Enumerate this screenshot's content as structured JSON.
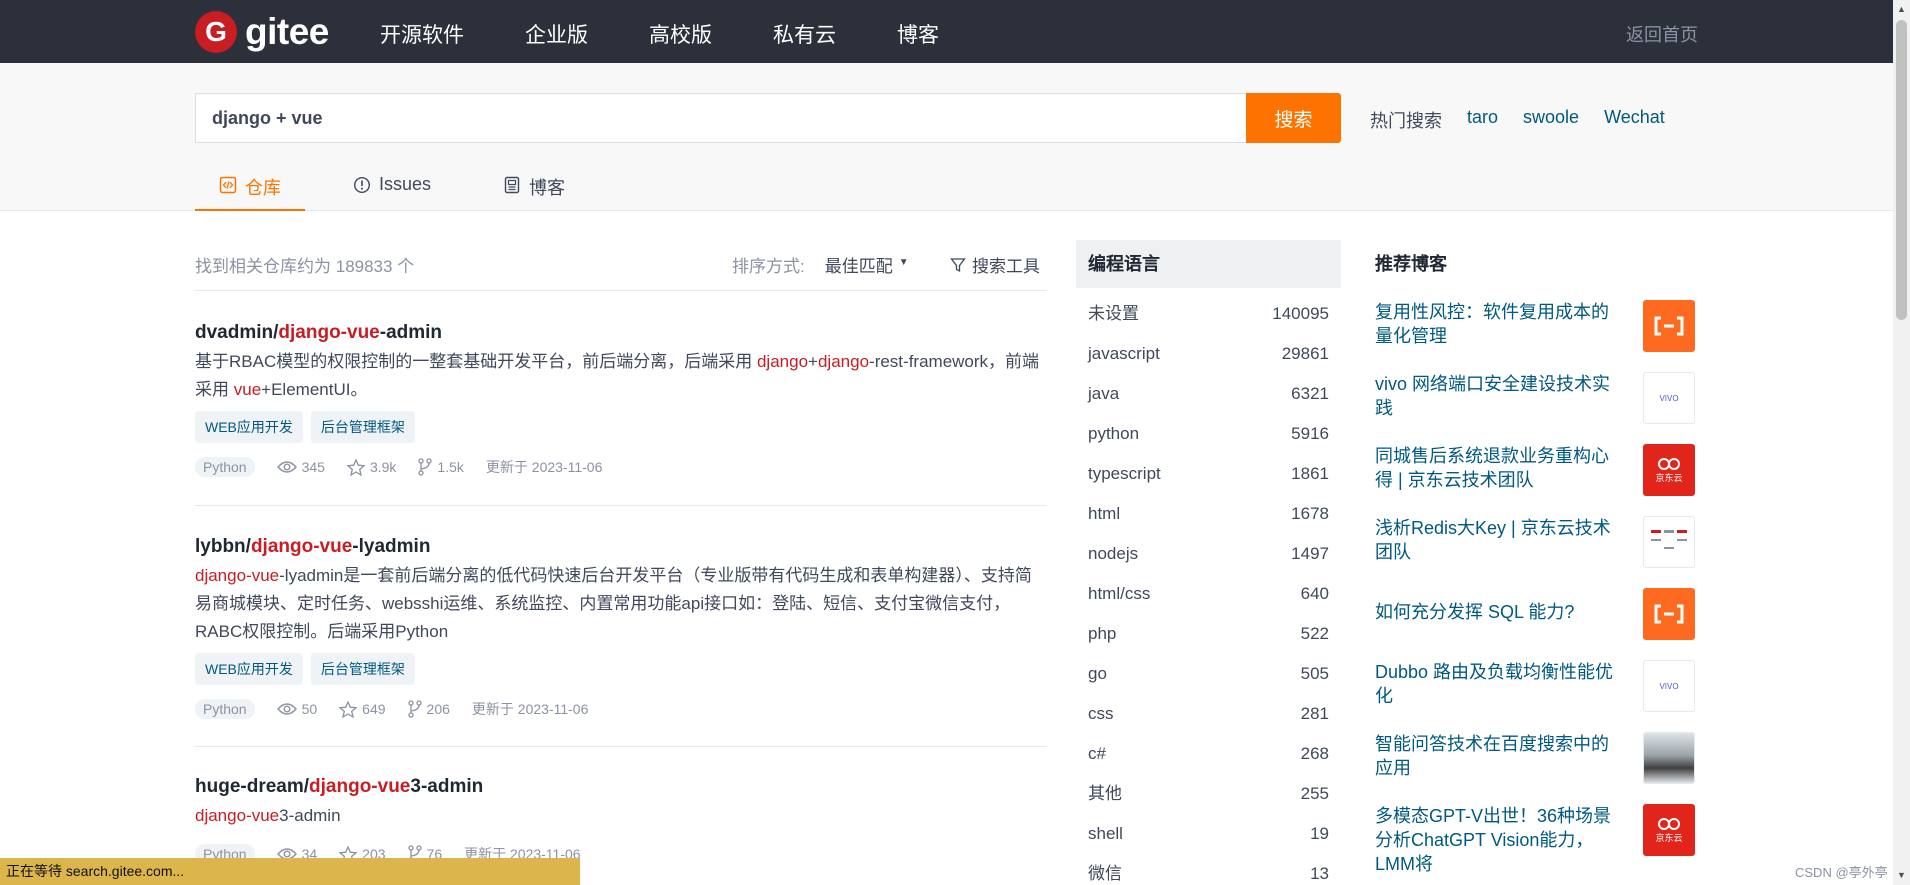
{
  "header": {
    "logo_mark": "G",
    "logo_text": "gitee",
    "nav": [
      "开源软件",
      "企业版",
      "高校版",
      "私有云",
      "博客"
    ],
    "home_link": "返回首页"
  },
  "search": {
    "query": "django + vue",
    "button": "搜索",
    "hot_label": "热门搜索",
    "hot_terms": [
      "taro",
      "swoole",
      "Wechat"
    ]
  },
  "tabs": [
    {
      "label": "仓库",
      "icon": "code-icon",
      "active": true
    },
    {
      "label": "Issues",
      "icon": "issue-icon",
      "active": false
    },
    {
      "label": "博客",
      "icon": "blog-icon",
      "active": false
    }
  ],
  "results": {
    "found_prefix": "找到相关仓库约为",
    "found_count": "189833",
    "found_suffix": "个",
    "sort_label": "排序方式:",
    "sort_value": "最佳匹配",
    "tools_label": "搜索工具"
  },
  "repos": [
    {
      "owner": "dvadmin/",
      "name_hl": "django-vue",
      "name_rest": "-admin",
      "desc_parts": [
        {
          "t": "基于RBAC模型的权限控制的一整套基础开发平台，前后端分离，后端采用 ",
          "hl": false
        },
        {
          "t": "django",
          "hl": true
        },
        {
          "t": "+",
          "hl": false
        },
        {
          "t": "django",
          "hl": true
        },
        {
          "t": "-rest-framework，前端采用 ",
          "hl": false
        },
        {
          "t": "vue",
          "hl": true
        },
        {
          "t": "+ElementUI。",
          "hl": false
        }
      ],
      "tags": [
        "WEB应用开发",
        "后台管理框架"
      ],
      "lang": "Python",
      "watch": "345",
      "stars": "3.9k",
      "forks": "1.5k",
      "updated": "更新于 2023-11-06"
    },
    {
      "owner": "lybbn/",
      "name_hl": "django-vue",
      "name_rest": "-lyadmin",
      "desc_parts": [
        {
          "t": "django-vue",
          "hl": true
        },
        {
          "t": "-lyadmin是一套前后端分离的低代码快速后台开发平台（专业版带有代码生成和表单构建器）、支持简易商城模块、定时任务、websshi运维、系统监控、内置常用功能api接口如：登陆、短信、支付宝微信支付，RABC权限控制。后端采用Python",
          "hl": false
        }
      ],
      "tags": [
        "WEB应用开发",
        "后台管理框架"
      ],
      "lang": "Python",
      "watch": "50",
      "stars": "649",
      "forks": "206",
      "updated": "更新于 2023-11-06"
    },
    {
      "owner": "huge-dream/",
      "name_hl": "django-vue",
      "name_rest": "3-admin",
      "desc_parts": [
        {
          "t": "django-vue",
          "hl": true
        },
        {
          "t": "3-admin",
          "hl": false
        }
      ],
      "tags": [],
      "lang": "Python",
      "watch": "34",
      "stars": "203",
      "forks": "76",
      "updated": "更新于 2023-11-06"
    }
  ],
  "languages": {
    "heading": "编程语言",
    "items": [
      {
        "name": "未设置",
        "count": "140095"
      },
      {
        "name": "javascript",
        "count": "29861"
      },
      {
        "name": "java",
        "count": "6321"
      },
      {
        "name": "python",
        "count": "5916"
      },
      {
        "name": "typescript",
        "count": "1861"
      },
      {
        "name": "html",
        "count": "1678"
      },
      {
        "name": "nodejs",
        "count": "1497"
      },
      {
        "name": "html/css",
        "count": "640"
      },
      {
        "name": "php",
        "count": "522"
      },
      {
        "name": "go",
        "count": "505"
      },
      {
        "name": "css",
        "count": "281"
      },
      {
        "name": "c#",
        "count": "268"
      },
      {
        "name": "其他",
        "count": "255"
      },
      {
        "name": "shell",
        "count": "19"
      },
      {
        "name": "微信",
        "count": "13"
      }
    ]
  },
  "blogs": {
    "heading": "推荐博客",
    "items": [
      {
        "title": "复用性风控：软件复用成本的量化管理",
        "thumb": "orange"
      },
      {
        "title": "vivo 网络端口安全建设技术实践",
        "thumb": "vivo",
        "thumb_text": "VIVO"
      },
      {
        "title": "同城售后系统退款业务重构心得 | 京东云技术团队",
        "thumb": "jd",
        "thumb_text": "京东云"
      },
      {
        "title": "浅析Redis大Key | 京东云技术团队",
        "thumb": "redis"
      },
      {
        "title": "如何充分发挥 SQL 能力?",
        "thumb": "orange"
      },
      {
        "title": "Dubbo 路由及负载均衡性能优化",
        "thumb": "vivo",
        "thumb_text": "VIVO"
      },
      {
        "title": "智能问答技术在百度搜索中的应用",
        "thumb": "photo"
      },
      {
        "title": "多模态GPT-V出世！36种场景分析ChatGPT Vision能力，LMM将",
        "thumb": "jd",
        "thumb_text": "京东云"
      }
    ]
  },
  "status": {
    "text": "正在等待 search.gitee.com...",
    "watermark": "CSDN @亭外亭"
  }
}
